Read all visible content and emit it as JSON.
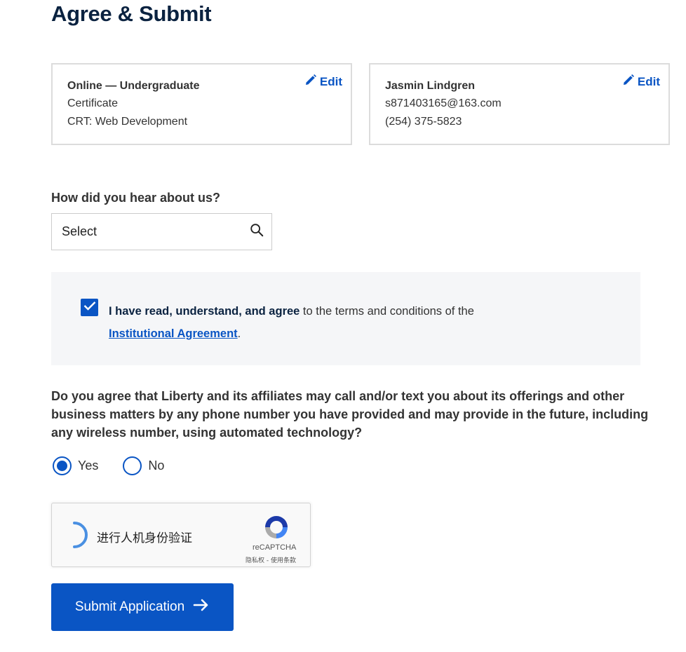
{
  "page": {
    "title": "Agree & Submit"
  },
  "program_card": {
    "line1": "Online — Undergraduate",
    "line2": "Certificate",
    "line3": "CRT: Web Development",
    "edit_label": "Edit"
  },
  "contact_card": {
    "name": "Jasmin Lindgren",
    "email": "s871403165@163.com",
    "phone": "(254) 375-5823",
    "edit_label": "Edit"
  },
  "referral": {
    "label": "How did you hear about us?",
    "selected_value": "Select"
  },
  "agreement": {
    "checked": true,
    "bold_text": "I have read, understand, and agree",
    "text": " to the terms and conditions of the",
    "link_text": "Institutional Agreement",
    "suffix": "."
  },
  "consent": {
    "question": "Do you agree that Liberty and its affiliates may call and/or text you about its offerings and other business matters by any phone number you have provided and may provide in the future, including any wireless number, using automated technology?",
    "options": [
      {
        "label": "Yes",
        "selected": true
      },
      {
        "label": "No",
        "selected": false
      }
    ]
  },
  "captcha": {
    "label": "进行人机身份验证",
    "brand": "reCAPTCHA",
    "terms": "隐私权 - 使用条款"
  },
  "submit": {
    "label": "Submit Application"
  },
  "colors": {
    "accent": "#0a55c4",
    "title": "#0a2240",
    "panel": "#f5f6f8"
  }
}
